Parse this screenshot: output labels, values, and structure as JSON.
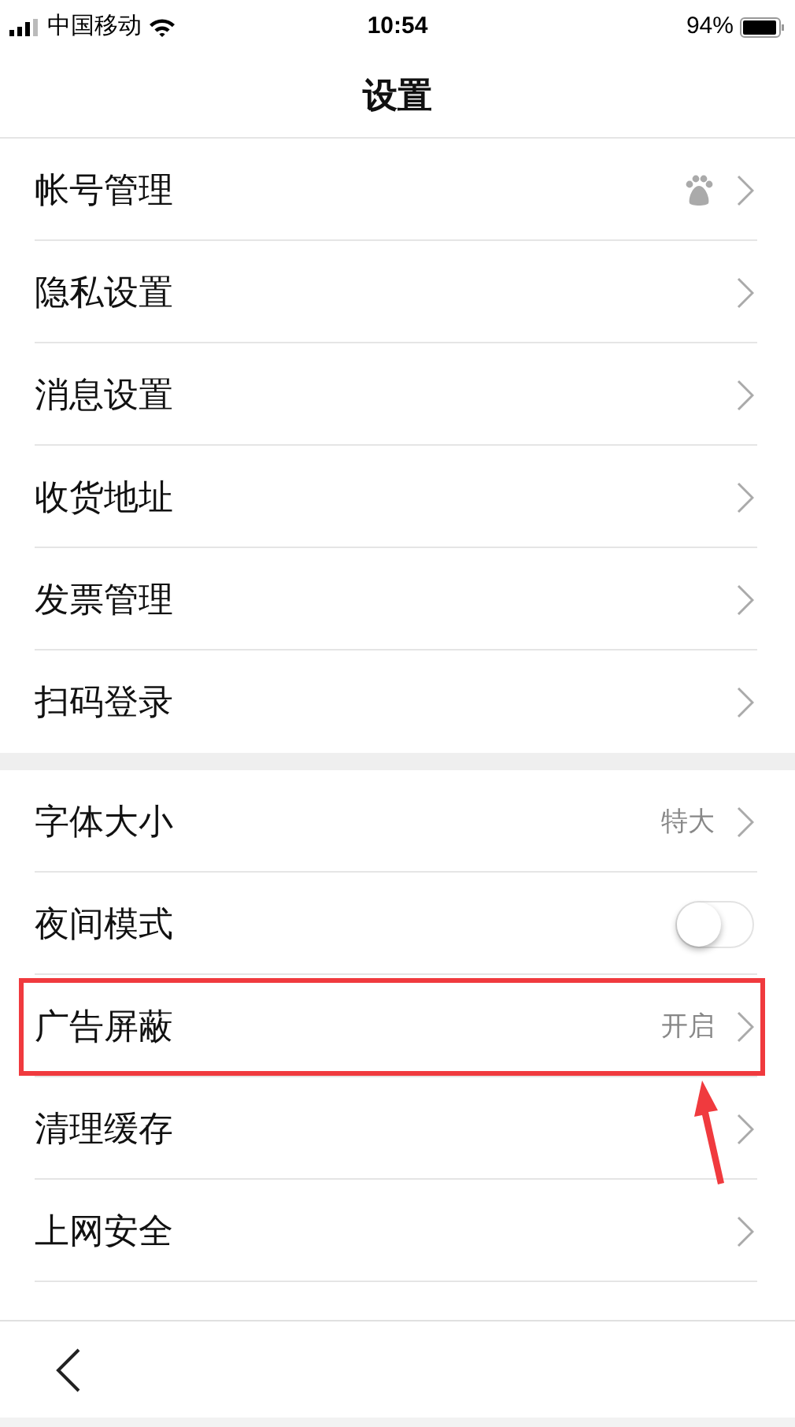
{
  "status_bar": {
    "carrier": "中国移动",
    "time": "10:54",
    "battery": "94%"
  },
  "header": {
    "title": "设置"
  },
  "groups": [
    {
      "rows": [
        {
          "label": "帐号管理",
          "kind": "link",
          "badge": true
        },
        {
          "label": "隐私设置",
          "kind": "link"
        },
        {
          "label": "消息设置",
          "kind": "link"
        },
        {
          "label": "收货地址",
          "kind": "link"
        },
        {
          "label": "发票管理",
          "kind": "link"
        },
        {
          "label": "扫码登录",
          "kind": "link"
        }
      ]
    },
    {
      "rows": [
        {
          "label": "字体大小",
          "kind": "link",
          "value": "特大"
        },
        {
          "label": "夜间模式",
          "kind": "toggle",
          "on": false
        },
        {
          "label": "广告屏蔽",
          "kind": "link",
          "value": "开启",
          "highlighted": true
        },
        {
          "label": "清理缓存",
          "kind": "link"
        },
        {
          "label": "上网安全",
          "kind": "link"
        }
      ]
    }
  ]
}
